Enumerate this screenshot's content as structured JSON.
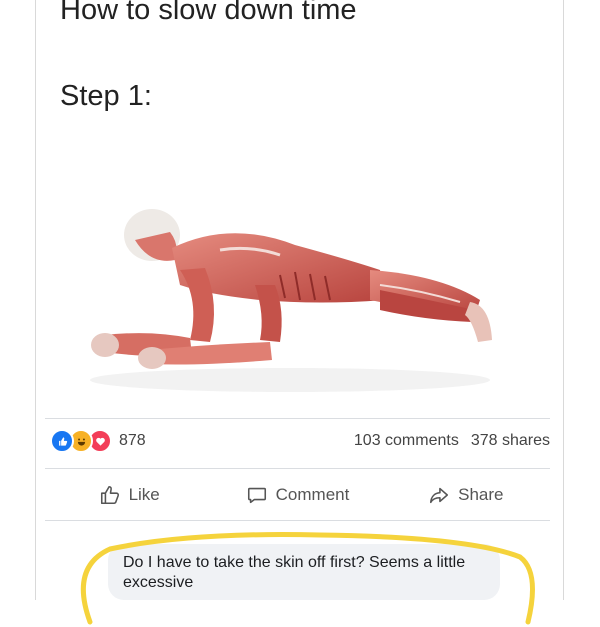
{
  "post": {
    "title": "How to slow down time",
    "step_label": "Step 1:"
  },
  "stats": {
    "reaction_count": "878",
    "reaction_icons": [
      "like-icon",
      "haha-icon",
      "love-icon"
    ],
    "comments": "103 comments",
    "shares": "378 shares"
  },
  "actions": {
    "like": "Like",
    "comment": "Comment",
    "share": "Share"
  },
  "comment": {
    "text": "Do I have to take the skin off first? Seems a little excessive"
  },
  "colors": {
    "like_blue": "#1877f2",
    "haha_yellow": "#f7b125",
    "love_red": "#f33e58",
    "highlight_yellow": "#f5d33c",
    "muscle_red": "#c9554d"
  }
}
